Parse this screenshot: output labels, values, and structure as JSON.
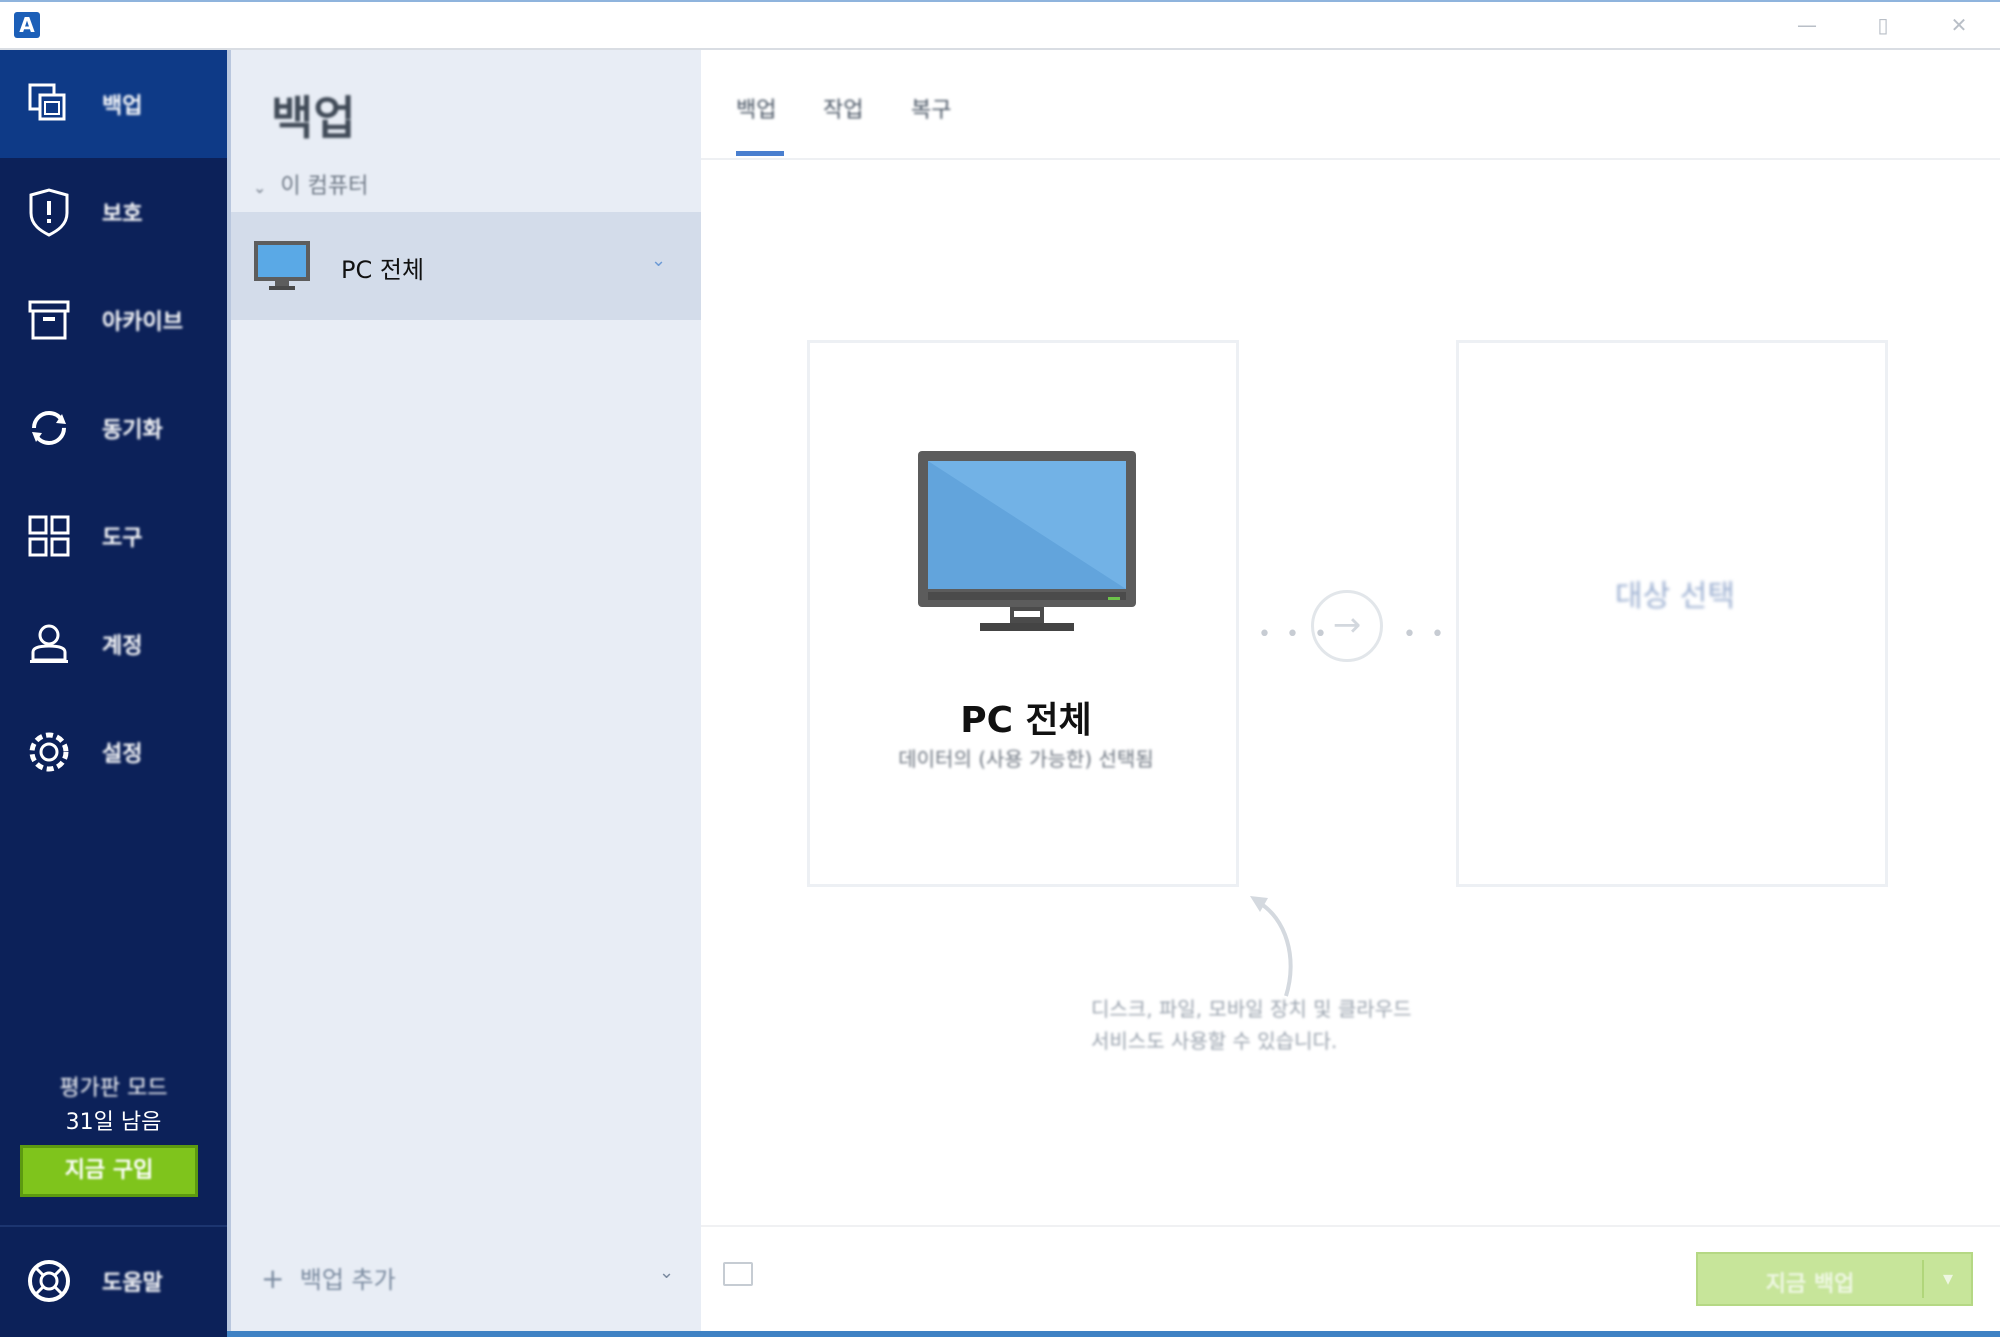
{
  "app": {
    "logo_letter": "A",
    "window_controls": {
      "minimize": "—",
      "maximize": "▯",
      "close": "✕"
    }
  },
  "sidebar": {
    "items": [
      {
        "label": "백업",
        "icon": "backup-icon"
      },
      {
        "label": "보호",
        "icon": "shield-icon"
      },
      {
        "label": "아카이브",
        "icon": "archive-icon"
      },
      {
        "label": "동기화",
        "icon": "sync-icon"
      },
      {
        "label": "도구",
        "icon": "tools-icon"
      },
      {
        "label": "계정",
        "icon": "account-icon"
      },
      {
        "label": "설정",
        "icon": "gear-icon"
      }
    ],
    "trial_line1": "평가판 모드",
    "trial_line2": "31일 남음",
    "buy_label": "지금 구입",
    "help_label": "도움말",
    "help_icon": "help-icon"
  },
  "list_panel": {
    "title": "백업",
    "group_header": "이 컴퓨터",
    "items": [
      {
        "label": "PC 전체",
        "icon": "monitor-icon"
      }
    ],
    "add_backup_label": "백업 추가"
  },
  "main": {
    "tabs": [
      "백업",
      "작업",
      "복구"
    ],
    "active_tab": 0,
    "source": {
      "title": "PC 전체",
      "subtitle": "데이터의 (사용 가능한) 선택됨"
    },
    "destination": {
      "label": "대상 선택"
    },
    "hint_line1": "디스크, 파일, 모바일 장치 및 클라우드",
    "hint_line2": "서비스도 사용할 수 있습니다.",
    "backup_button_label": "지금 백업",
    "backup_button_dropdown": "▾"
  },
  "colors": {
    "sidebar": "#0c2159",
    "sidebar_active": "#0e3a87",
    "accent_blue": "#4a7fcf",
    "buy_green": "#7fc41c",
    "backup_green_disabled": "#c7e59a"
  }
}
